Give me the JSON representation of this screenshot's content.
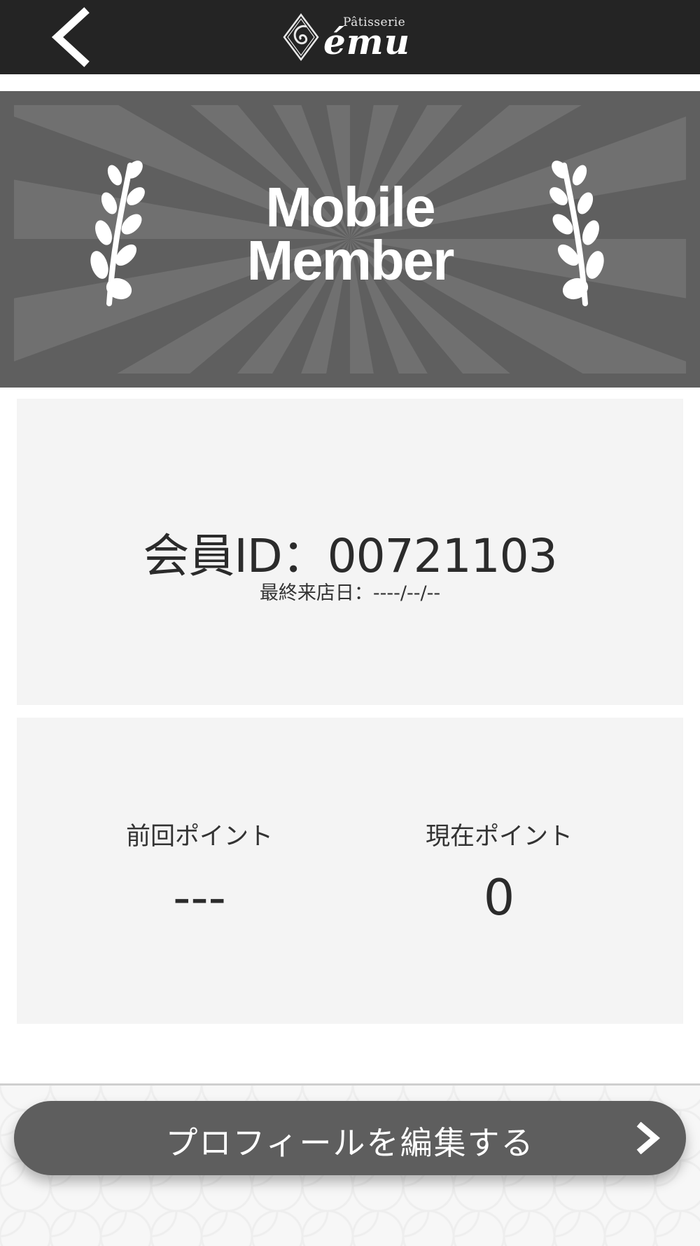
{
  "header": {
    "back_icon": "chevron-left-icon",
    "logo_sub": "Pâtisserie",
    "logo_main": "ému"
  },
  "banner": {
    "title_line1": "Mobile",
    "title_line2": "Member",
    "decoration": "laurel-branch-icon"
  },
  "member": {
    "id_label": "会員ID：",
    "id_value": "00721103",
    "last_visit_label": "最終来店日：",
    "last_visit_value": "----/--/--"
  },
  "points": {
    "previous_label": "前回ポイント",
    "previous_value": "---",
    "current_label": "現在ポイント",
    "current_value": "0"
  },
  "profile_button": {
    "label": "プロフィールを編集する",
    "icon": "chevron-right-icon"
  },
  "colors": {
    "header_bg": "#242424",
    "banner_bg": "#5f5f5f",
    "card_bg": "#f4f4f4",
    "button_bg": "#5e5e5e"
  }
}
